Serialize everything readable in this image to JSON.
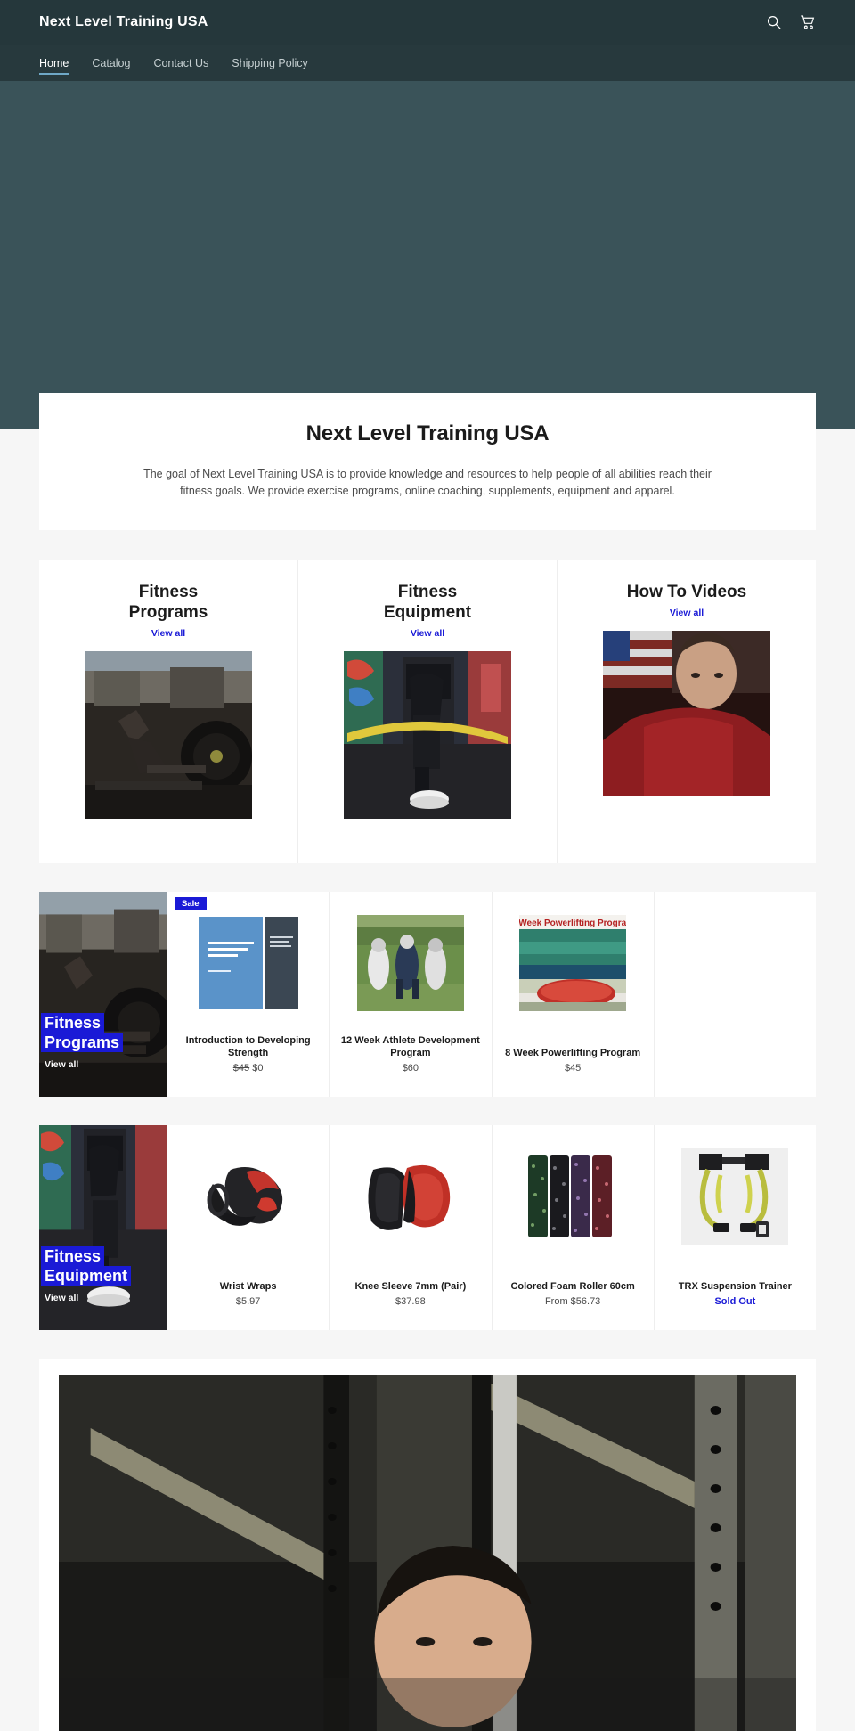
{
  "header": {
    "site_title": "Next Level Training USA",
    "icons": [
      {
        "name": "search-icon",
        "label": "Search"
      },
      {
        "name": "cart-icon",
        "label": "Cart"
      }
    ]
  },
  "nav": {
    "items": [
      {
        "label": "Home",
        "active": true
      },
      {
        "label": "Catalog",
        "active": false
      },
      {
        "label": "Contact Us",
        "active": false
      },
      {
        "label": "Shipping Policy",
        "active": false
      }
    ]
  },
  "intro": {
    "title": "Next Level Training USA",
    "body": "The goal of Next Level Training USA is to provide knowledge and resources to help people of all abilities reach their fitness goals.  We provide exercise programs, online coaching, supplements, equipment and apparel."
  },
  "collections": {
    "view_all_label": "View all",
    "items": [
      {
        "title_line1": "Fitness",
        "title_line2": "Programs",
        "view_all": "View all"
      },
      {
        "title_line1": "Fitness",
        "title_line2": "Equipment",
        "view_all": "View all"
      },
      {
        "title_line1": "How To Videos",
        "title_line2": "",
        "view_all": "View all"
      }
    ]
  },
  "programs_section": {
    "banner": {
      "line1": "Fitness",
      "line2": "Programs",
      "view_all": "View all"
    },
    "products": [
      {
        "name": "Introduction to Developing Strength",
        "price_was": "$45",
        "price_now": "$0",
        "badge": "Sale",
        "sold_out": ""
      },
      {
        "name": "12 Week Athlete Development Program",
        "price_was": "",
        "price_now": "$60",
        "badge": "",
        "sold_out": ""
      },
      {
        "name": "8 Week Powerlifting Program",
        "price_was": "",
        "price_now": "$45",
        "badge": "",
        "sold_out": ""
      }
    ]
  },
  "equipment_section": {
    "banner": {
      "line1": "Fitness",
      "line2": "Equipment",
      "view_all": "View all"
    },
    "products": [
      {
        "name": "Wrist Wraps",
        "price_was": "",
        "price_now": "$5.97",
        "badge": "",
        "sold_out": ""
      },
      {
        "name": "Knee Sleeve 7mm (Pair)",
        "price_was": "",
        "price_now": "$37.98",
        "badge": "",
        "sold_out": ""
      },
      {
        "name": "Colored Foam Roller 60cm",
        "price_was": "",
        "price_now": "From $56.73",
        "badge": "",
        "sold_out": ""
      },
      {
        "name": "TRX Suspension Trainer",
        "price_was": "",
        "price_now": "",
        "badge": "",
        "sold_out": "Sold Out"
      }
    ]
  },
  "colors": {
    "header_bg": "#25373b",
    "nav_bg": "#27393d",
    "hero_bg": "#3a5359",
    "page_bg": "#f6f6f6",
    "accent_blue": "#1a1ad6",
    "nav_active_underline": "#6fa8c7"
  }
}
